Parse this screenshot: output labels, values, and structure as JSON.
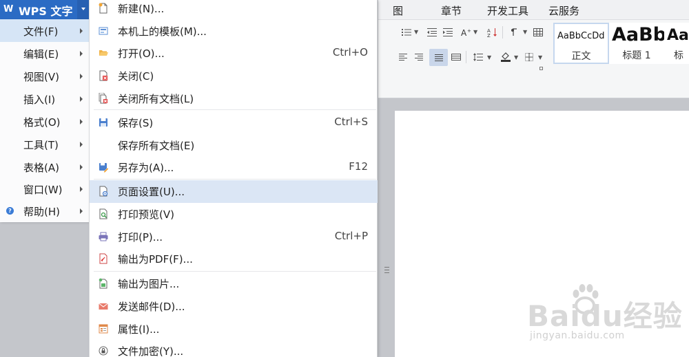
{
  "app": {
    "title": "WPS 文字",
    "logo_letter": "W"
  },
  "colors": {
    "header_blue": "#2b6bc4",
    "hover_blue": "#dbe6f5",
    "active_menu": "#d6e5f6",
    "bg_gray": "#c4c6cb"
  },
  "main_menu": {
    "items": [
      {
        "label": "文件(F)",
        "active": true
      },
      {
        "label": "编辑(E)"
      },
      {
        "label": "视图(V)"
      },
      {
        "label": "插入(I)"
      },
      {
        "label": "格式(O)"
      },
      {
        "label": "工具(T)"
      },
      {
        "label": "表格(A)"
      },
      {
        "label": "窗口(W)"
      },
      {
        "label": "帮助(H)",
        "icon": "help-icon"
      }
    ]
  },
  "file_menu": {
    "items": [
      {
        "label": "新建(N)...",
        "icon": "new-document-icon",
        "shortcut": ""
      },
      {
        "label": "本机上的模板(M)...",
        "icon": "template-icon",
        "shortcut": ""
      },
      {
        "label": "打开(O)...",
        "icon": "folder-open-icon",
        "shortcut": "Ctrl+O"
      },
      {
        "label": "关闭(C)",
        "icon": "close-document-icon",
        "shortcut": ""
      },
      {
        "label": "关闭所有文档(L)",
        "icon": "close-all-icon",
        "shortcut": ""
      },
      {
        "label": "保存(S)",
        "icon": "save-icon",
        "shortcut": "Ctrl+S"
      },
      {
        "label": "保存所有文档(E)",
        "icon": "",
        "shortcut": ""
      },
      {
        "label": "另存为(A)...",
        "icon": "save-as-icon",
        "shortcut": "F12"
      },
      {
        "label": "页面设置(U)...",
        "icon": "page-setup-icon",
        "shortcut": "",
        "hover": true
      },
      {
        "label": "打印预览(V)",
        "icon": "print-preview-icon",
        "shortcut": ""
      },
      {
        "label": "打印(P)...",
        "icon": "printer-icon",
        "shortcut": "Ctrl+P"
      },
      {
        "label": "输出为PDF(F)...",
        "icon": "pdf-icon",
        "shortcut": ""
      },
      {
        "label": "输出为图片...",
        "icon": "image-export-icon",
        "shortcut": ""
      },
      {
        "label": "发送邮件(D)...",
        "icon": "mail-icon",
        "shortcut": ""
      },
      {
        "label": "属性(I)...",
        "icon": "properties-icon",
        "shortcut": ""
      },
      {
        "label": "文件加密(Y)...",
        "icon": "encrypt-icon",
        "shortcut": ""
      }
    ]
  },
  "ribbon": {
    "tabs": [
      "图",
      "章节",
      "开发工具",
      "云服务"
    ],
    "styles": [
      {
        "sample": "AaBbCcDd",
        "name": "正文",
        "selected": true
      },
      {
        "sample": "AaBb",
        "name": "标题 1"
      },
      {
        "sample": "Aa",
        "name": "标"
      }
    ]
  },
  "watermark": {
    "main": "Baidu经验",
    "sub": "jingyan.baidu.com"
  }
}
